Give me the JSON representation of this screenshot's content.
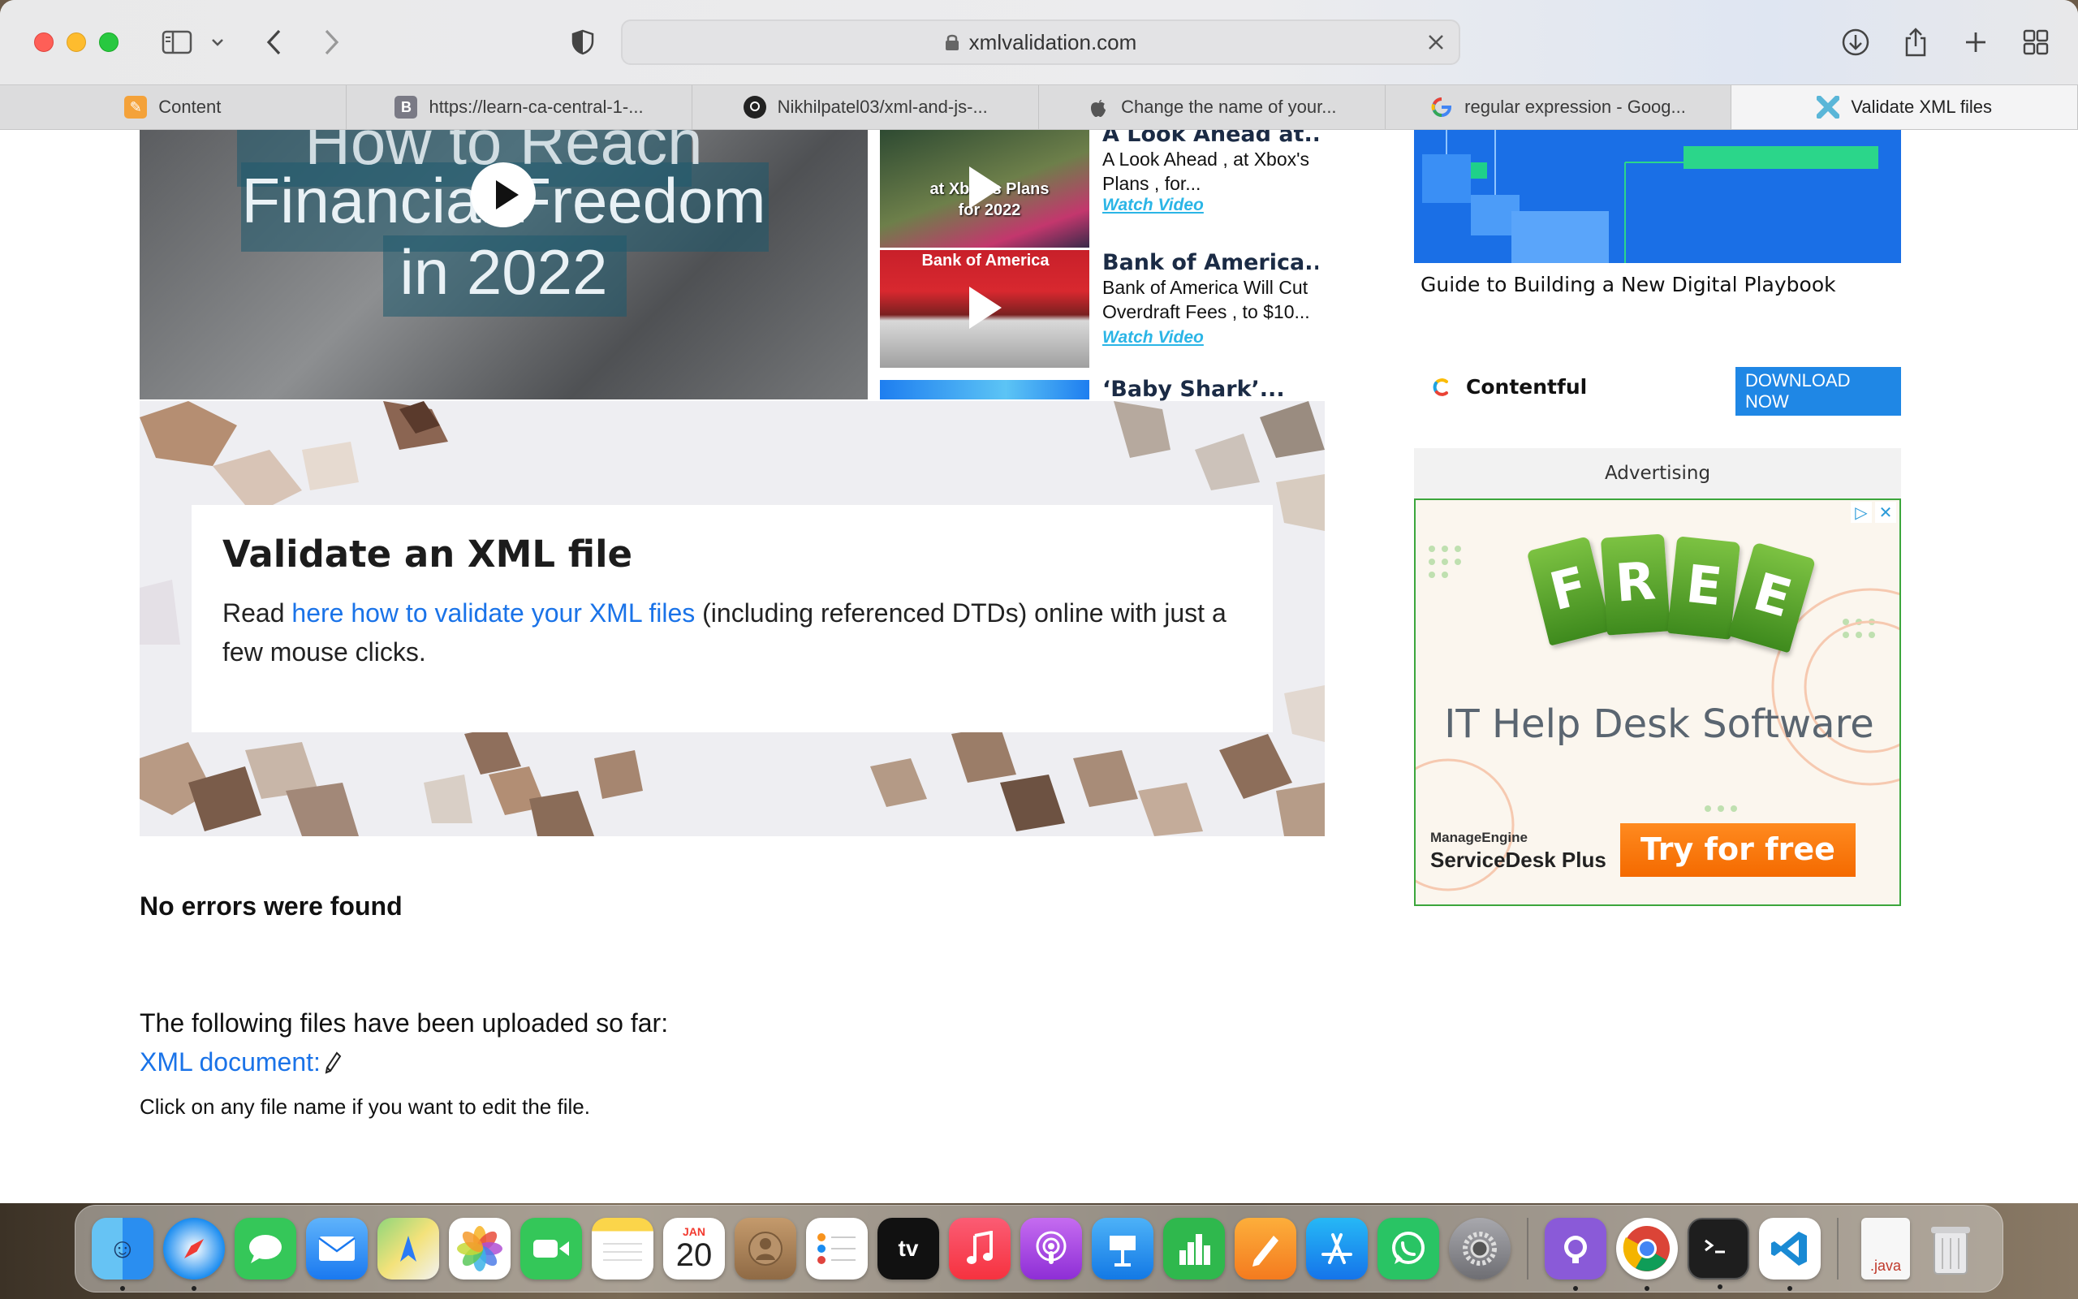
{
  "browser": {
    "url": "xmlvalidation.com",
    "tabs": [
      {
        "label": "Content",
        "icon": "pencil-note-icon",
        "active": false
      },
      {
        "label": "https://learn-ca-central-1-...",
        "icon": "b-letter-icon",
        "active": false
      },
      {
        "label": "Nikhilpatel03/xml-and-js-...",
        "icon": "github-icon",
        "active": false
      },
      {
        "label": "Change the name of your...",
        "icon": "apple-icon",
        "active": false
      },
      {
        "label": "regular expression - Goog...",
        "icon": "google-icon",
        "active": false
      },
      {
        "label": "Validate XML files",
        "icon": "xml-x-icon",
        "active": true
      }
    ]
  },
  "videos": {
    "main": {
      "line1": "How to Reach",
      "line2": "Financial Freedom",
      "line3": "in 2022"
    },
    "list": [
      {
        "title": "A Look Ahead at...",
        "desc": "A Look Ahead , at Xbox's Plans , for...",
        "link": "Watch Video",
        "thumb_text": "at Xbox's Plans for 2022"
      },
      {
        "title": "Bank of America...",
        "desc": "Bank of America Will Cut Overdraft Fees , to $10...",
        "link": "Watch Video",
        "thumb_text": "Bank of America"
      },
      {
        "title": "‘Baby Shark’...",
        "desc": "",
        "link": ""
      }
    ]
  },
  "hero": {
    "heading": "Validate an XML file",
    "text_before": "Read ",
    "link": "here how to validate your XML files",
    "text_after": " (including referenced DTDs) online with just a few mouse clicks."
  },
  "results": {
    "status": "No errors were found",
    "uploaded_label": "The following files have been uploaded so far:",
    "file_link": "XML document:",
    "hint": "Click on any file name if you want to edit the file."
  },
  "sidebar": {
    "ad_caption": "Guide to Building a New Digital Playbook",
    "brand": "Contentful",
    "download_button": "DOWNLOAD NOW",
    "advertising_label": "Advertising",
    "ad": {
      "tag_letters": [
        "F",
        "R",
        "E",
        "E"
      ],
      "heading": "IT Help Desk Software",
      "brand_small": "ManageEngine",
      "brand_product": "ServiceDesk Plus",
      "cta": "Try for free"
    }
  },
  "dock": {
    "apps": [
      "finder-icon",
      "safari-icon",
      "messages-icon",
      "mail-icon",
      "maps-icon",
      "photos-icon",
      "facetime-icon",
      "notes-icon",
      "calendar-icon",
      "contacts-icon",
      "reminders-icon",
      "apple-tv-icon",
      "music-icon",
      "podcasts-icon",
      "keynote-icon",
      "numbers-icon",
      "pages-icon",
      "app-store-icon",
      "whatsapp-icon",
      "system-preferences-icon",
      "github-desktop-icon",
      "chrome-icon",
      "terminal-icon",
      "vscode-icon",
      "java-file-icon",
      "trash-icon"
    ],
    "calendar_month": "JAN",
    "calendar_day": "20",
    "tv_label": "tv",
    "java_label": ".java"
  },
  "colors": {
    "link": "#1a73e8",
    "accent_blue": "#1f87e5",
    "ad_orange": "#f46a00",
    "ad_green": "#3ca63c"
  }
}
